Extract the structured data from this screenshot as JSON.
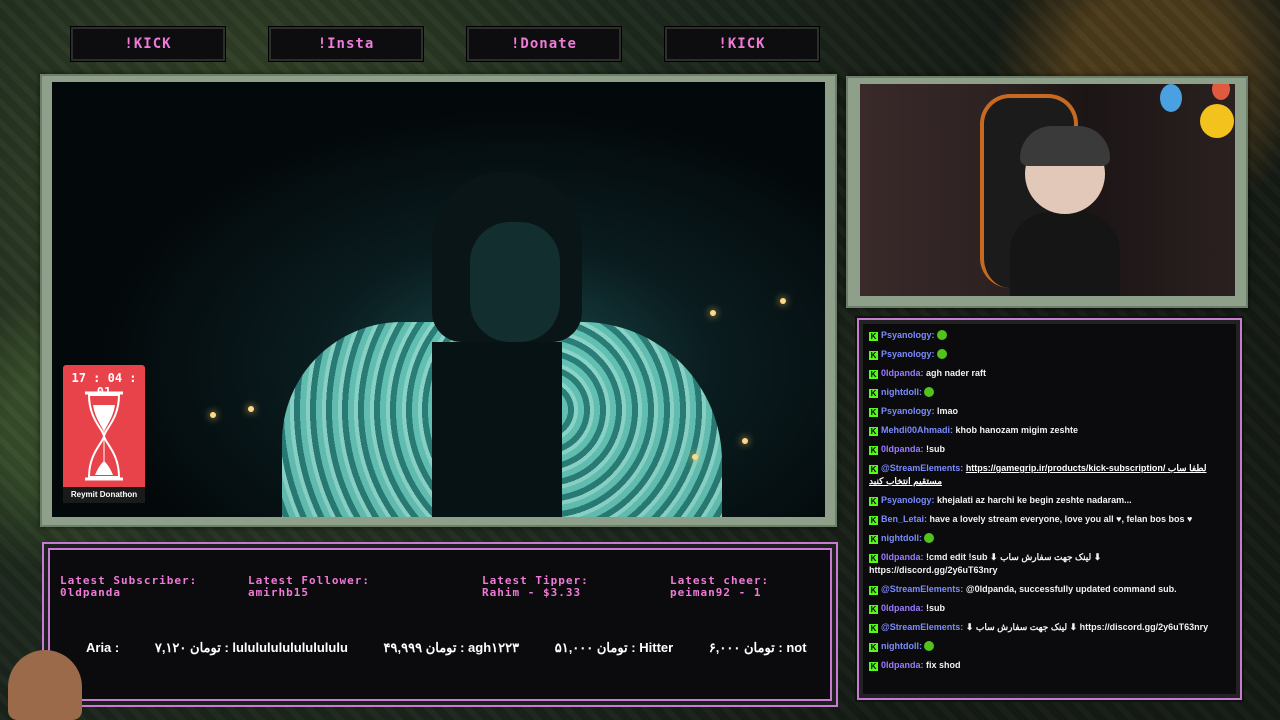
{
  "top_buttons": [
    "!KICK",
    "!Insta",
    "!Donate",
    "!KICK"
  ],
  "timer": {
    "time": "17 : 04 : 01",
    "label": "Reymit Donathon"
  },
  "info": {
    "latest_subscriber_label": "Latest Subscriber:",
    "latest_subscriber_value": "0ldpanda",
    "latest_follower_label": "Latest Follower:",
    "latest_follower_value": "amirhb15",
    "latest_tipper_label": "Latest Tipper:",
    "latest_tipper_value": "Rahim - $3.33",
    "latest_cheer_label": "Latest cheer:",
    "latest_cheer_value": "peiman92 - 1"
  },
  "ticker": [
    "Aria :",
    "۷,۱۲۰ تومان : lulululululululululu",
    "۴۹,۹۹۹ تومان : agh۱۲۲۳",
    "۵۱,۰۰۰ تومان : Hitter",
    "۶,۰۰۰ تومان : not"
  ],
  "chat": [
    {
      "user": "Psyanology:",
      "text": "",
      "emote": true
    },
    {
      "user": "Psyanology:",
      "text": "",
      "emote": true
    },
    {
      "user": "0ldpanda:",
      "text": "agh nader raft"
    },
    {
      "user": "nightdoll:",
      "text": "",
      "emote": true
    },
    {
      "user": "Psyanology:",
      "text": "lmao"
    },
    {
      "user": "Mehdi00Ahmadi:",
      "text": "khob hanozam migim zeshte"
    },
    {
      "user": "0ldpanda:",
      "text": "!sub"
    },
    {
      "user": "@StreamElements:",
      "text": "https://gamegrip.ir/products/kick-subscription/ لطفا ساب مستقیم انتخاب کنید",
      "link": true
    },
    {
      "user": "Psyanology:",
      "text": "khejalati az harchi ke begin zeshte nadaram..."
    },
    {
      "user": "Ben_Letai:",
      "text": "have a lovely stream everyone, love you all ♥, felan bos bos ♥"
    },
    {
      "user": "nightdoll:",
      "text": "",
      "emote": true
    },
    {
      "user": "0ldpanda:",
      "text": "!cmd edit !sub ⬇ لینک جهت سفارش ساب ⬇ https://discord.gg/2y6uT63nry"
    },
    {
      "user": "@StreamElements:",
      "text": "@0ldpanda, successfully updated command sub."
    },
    {
      "user": "0ldpanda:",
      "text": "!sub"
    },
    {
      "user": "@StreamElements:",
      "text": "⬇ لینک جهت سفارش ساب ⬇ https://discord.gg/2y6uT63nry"
    },
    {
      "user": "nightdoll:",
      "text": "",
      "emote": true
    },
    {
      "user": "0ldpanda:",
      "text": "fix shod"
    }
  ],
  "icons": {
    "kick_badge": "kick-badge-icon",
    "hourglass": "hourglass-icon"
  },
  "colors": {
    "accent_pink": "#f07ad8",
    "kick_green": "#53fc18",
    "timer_red": "#e8424a"
  }
}
